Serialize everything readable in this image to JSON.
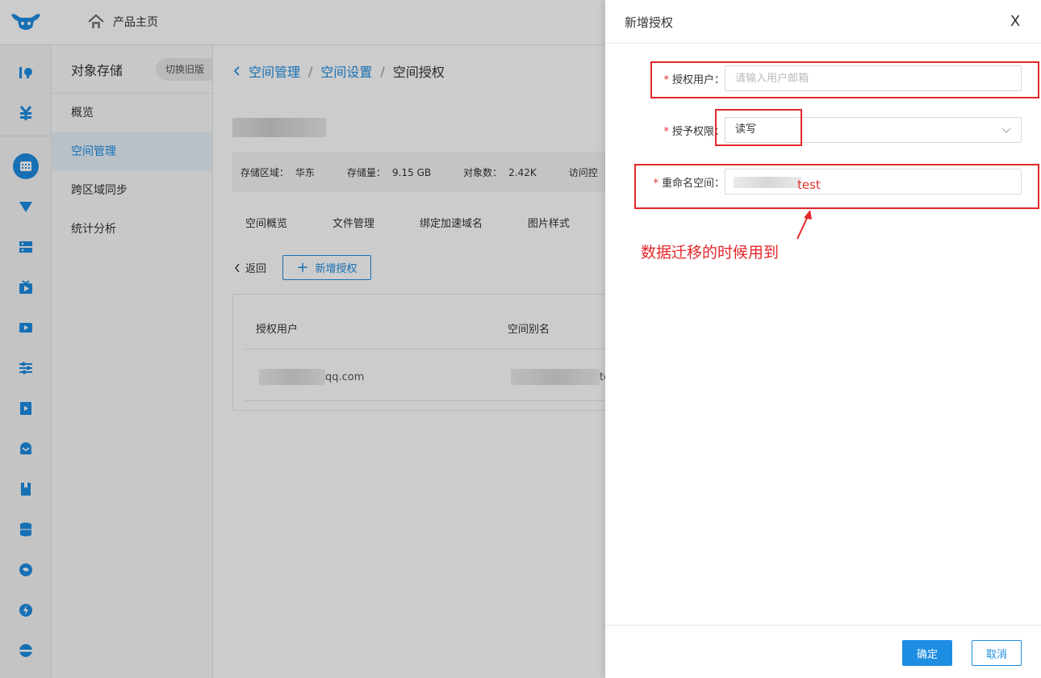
{
  "header": {
    "home_label": "产品主页"
  },
  "sidebar": {
    "title": "对象存储",
    "switch_label": "切换旧版",
    "items": [
      {
        "label": "概览"
      },
      {
        "label": "空间管理"
      },
      {
        "label": "跨区域同步"
      },
      {
        "label": "统计分析"
      }
    ]
  },
  "breadcrumb": {
    "level1": "空间管理",
    "sep": "/",
    "level2": "空间设置",
    "current": "空间授权"
  },
  "stats": {
    "region_label": "存储区域：",
    "region_value": "华东",
    "storage_label": "存储量：",
    "storage_value": "9.15 GB",
    "objects_label": "对象数：",
    "objects_value": "2.42K",
    "access_label": "访问控"
  },
  "tabs": [
    "空间概览",
    "文件管理",
    "绑定加速域名",
    "图片样式"
  ],
  "actions": {
    "back": "返回",
    "add": "新增授权"
  },
  "table": {
    "headers": [
      "授权用户",
      "空间别名"
    ],
    "rows": [
      {
        "user_suffix": "qq.com",
        "alias_suffix": "te"
      }
    ]
  },
  "drawer": {
    "title": "新增授权",
    "close": "X",
    "fields": {
      "user": {
        "label": "授权用户：",
        "placeholder": "请输入用户邮箱"
      },
      "permission": {
        "label": "授予权限：",
        "value": "读写"
      },
      "rename": {
        "label": "重命名空间：",
        "typed": "test"
      }
    },
    "annotation": "数据迁移的时候用到",
    "ok": "确定",
    "cancel": "取消"
  },
  "colors": {
    "accent": "#1d8de1",
    "annotation": "#e3262a"
  }
}
